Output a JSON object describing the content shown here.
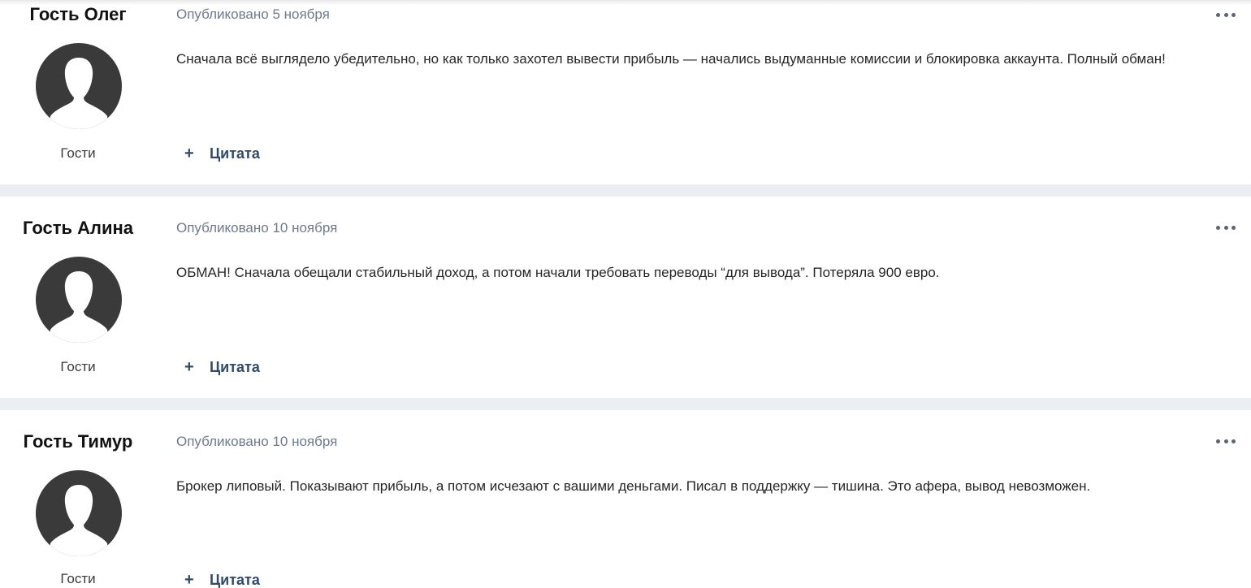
{
  "posts": [
    {
      "author": "Гость Олег",
      "date": "Опубликовано 5 ноября",
      "group": "Гости",
      "body": "Сначала всё выглядело убедительно, но как только захотел вывести прибыль — начались выдуманные комиссии и блокировка аккаунта. Полный обман!",
      "quote_label": "Цитата",
      "avatar_icon": "default-user-avatar-icon",
      "more_icon": "ellipsis-icon"
    },
    {
      "author": "Гость Алина",
      "date": "Опубликовано 10 ноября",
      "group": "Гости",
      "body": "ОБМАН! Сначала обещали стабильный доход, а потом начали требовать переводы “для вывода”. Потеряла 900 евро.",
      "quote_label": "Цитата",
      "avatar_icon": "default-user-avatar-icon",
      "more_icon": "ellipsis-icon"
    },
    {
      "author": "Гость Тимур",
      "date": "Опубликовано 10 ноября",
      "group": "Гости",
      "body": "Брокер липовый. Показывают прибыль, а потом исчезают с вашими деньгами. Писал в поддержку — тишина. Это афера, вывод невозможен.",
      "quote_label": "Цитата",
      "avatar_icon": "default-user-avatar-icon",
      "more_icon": "ellipsis-icon"
    }
  ],
  "colors": {
    "page_background": "#ebeef2",
    "post_background": "#ffffff",
    "author_text": "#111111",
    "date_text": "#6e7a89",
    "body_text": "#262626",
    "quote_accent": "#2f4a6a",
    "avatar_fill": "#3a3a3a"
  }
}
